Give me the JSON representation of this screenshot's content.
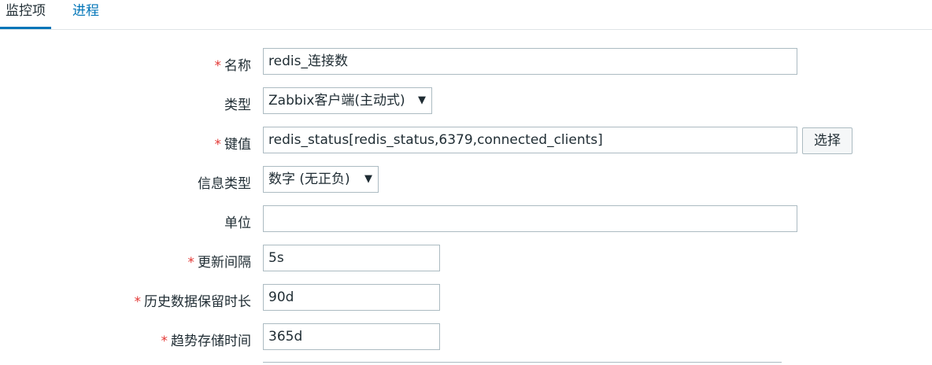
{
  "tabs": [
    {
      "label": "监控项"
    },
    {
      "label": "进程"
    }
  ],
  "form": {
    "name": {
      "label": "名称",
      "required": "*",
      "value": "redis_连接数"
    },
    "type": {
      "label": "类型",
      "value": "Zabbix客户端(主动式)"
    },
    "key": {
      "label": "键值",
      "required": "*",
      "value": "redis_status[redis_status,6379,connected_clients]",
      "button": "选择"
    },
    "info_type": {
      "label": "信息类型",
      "value": "数字 (无正负)"
    },
    "units": {
      "label": "单位",
      "value": ""
    },
    "interval": {
      "label": "更新间隔",
      "required": "*",
      "value": "5s"
    },
    "history": {
      "label": "历史数据保留时长",
      "required": "*",
      "value": "90d"
    },
    "trends": {
      "label": "趋势存储时间",
      "required": "*",
      "value": "365d"
    }
  },
  "icons": {
    "dropdown": "dropdown-arrow-icon"
  },
  "colors": {
    "accent": "#0275b8",
    "required": "#e33734",
    "border": "#acbbc2"
  }
}
